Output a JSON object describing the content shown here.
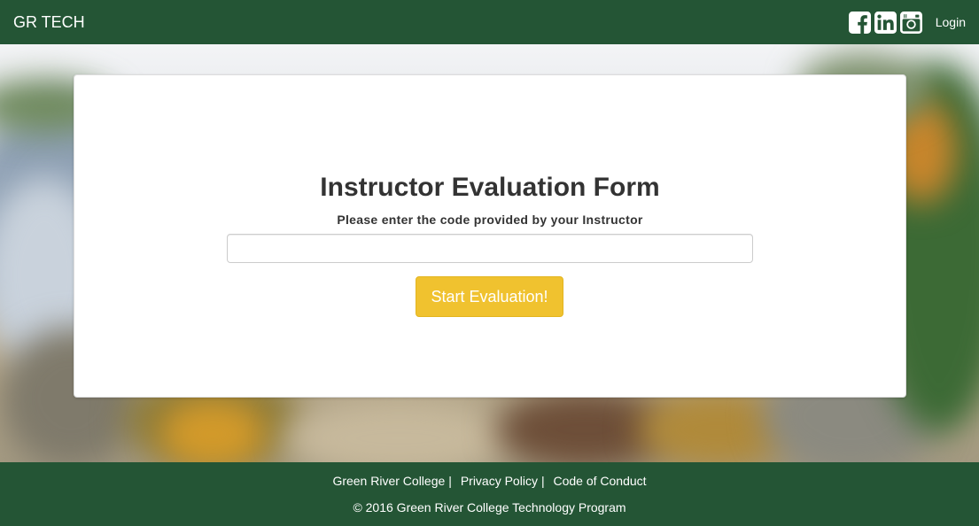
{
  "navbar": {
    "brand": "GR TECH",
    "login_label": "Login",
    "social": [
      "facebook-icon",
      "linkedin-icon",
      "instagram-icon"
    ]
  },
  "form": {
    "title": "Instructor Evaluation Form",
    "subtitle": "Please enter the code provided by your Instructor",
    "input_value": "",
    "button_label": "Start Evaluation!"
  },
  "footer": {
    "links": [
      "Green River College",
      "Privacy Policy",
      "Code of Conduct"
    ],
    "separator": "|",
    "copyright": "© 2016 Green River College Technology Program"
  },
  "colors": {
    "nav_green": "#245535",
    "button_yellow": "#f0c22f"
  }
}
